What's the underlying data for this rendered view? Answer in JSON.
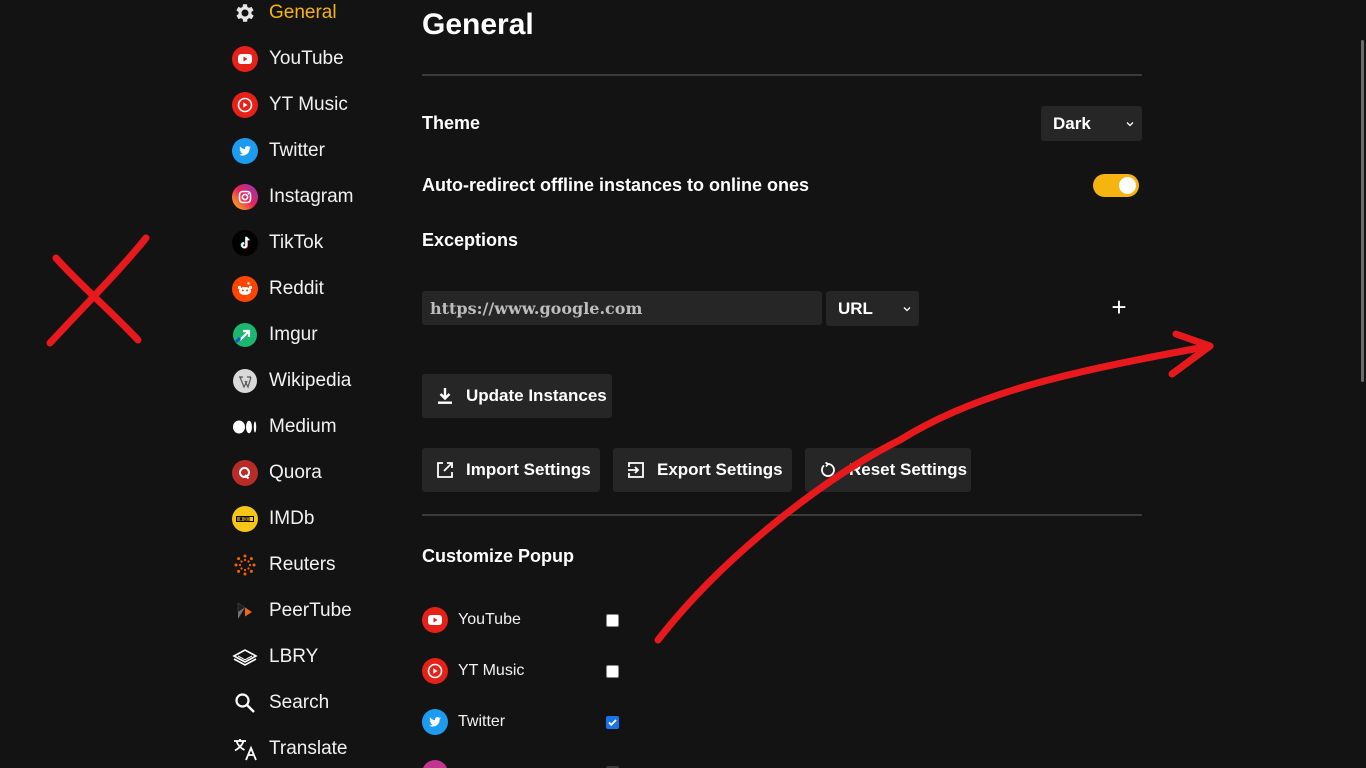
{
  "sidebar": {
    "items": [
      {
        "label": "General",
        "icon": "gear-icon"
      },
      {
        "label": "YouTube",
        "icon": "youtube-icon"
      },
      {
        "label": "YT Music",
        "icon": "yt-music-icon"
      },
      {
        "label": "Twitter",
        "icon": "twitter-icon"
      },
      {
        "label": "Instagram",
        "icon": "instagram-icon"
      },
      {
        "label": "TikTok",
        "icon": "tiktok-icon"
      },
      {
        "label": "Reddit",
        "icon": "reddit-icon"
      },
      {
        "label": "Imgur",
        "icon": "imgur-icon"
      },
      {
        "label": "Wikipedia",
        "icon": "wikipedia-icon"
      },
      {
        "label": "Medium",
        "icon": "medium-icon"
      },
      {
        "label": "Quora",
        "icon": "quora-icon"
      },
      {
        "label": "IMDb",
        "icon": "imdb-icon"
      },
      {
        "label": "Reuters",
        "icon": "reuters-icon"
      },
      {
        "label": "PeerTube",
        "icon": "peertube-icon"
      },
      {
        "label": "LBRY",
        "icon": "lbry-icon"
      },
      {
        "label": "Search",
        "icon": "search-icon"
      },
      {
        "label": "Translate",
        "icon": "translate-icon"
      }
    ],
    "active_color": "#f6b40e"
  },
  "main": {
    "title": "General",
    "theme": {
      "label": "Theme",
      "value": "Dark"
    },
    "auto_redirect": {
      "label": "Auto-redirect offline instances to online ones",
      "enabled": true
    },
    "exceptions": {
      "label": "Exceptions",
      "input_value": "https://www.google.com",
      "type_value": "URL",
      "add_symbol": "+"
    },
    "buttons": {
      "update": "Update Instances",
      "import": "Import Settings",
      "export": "Export Settings",
      "reset": "Reset Settings"
    },
    "popup": {
      "title": "Customize Popup",
      "items": [
        {
          "label": "YouTube",
          "icon": "youtube-icon",
          "checked": false
        },
        {
          "label": "YT Music",
          "icon": "yt-music-icon",
          "checked": false
        },
        {
          "label": "Twitter",
          "icon": "twitter-icon",
          "checked": true
        }
      ]
    }
  },
  "colors": {
    "background": "#131313",
    "control": "#262626",
    "accent": "#f6b40e",
    "annotation": "#e8191c"
  }
}
